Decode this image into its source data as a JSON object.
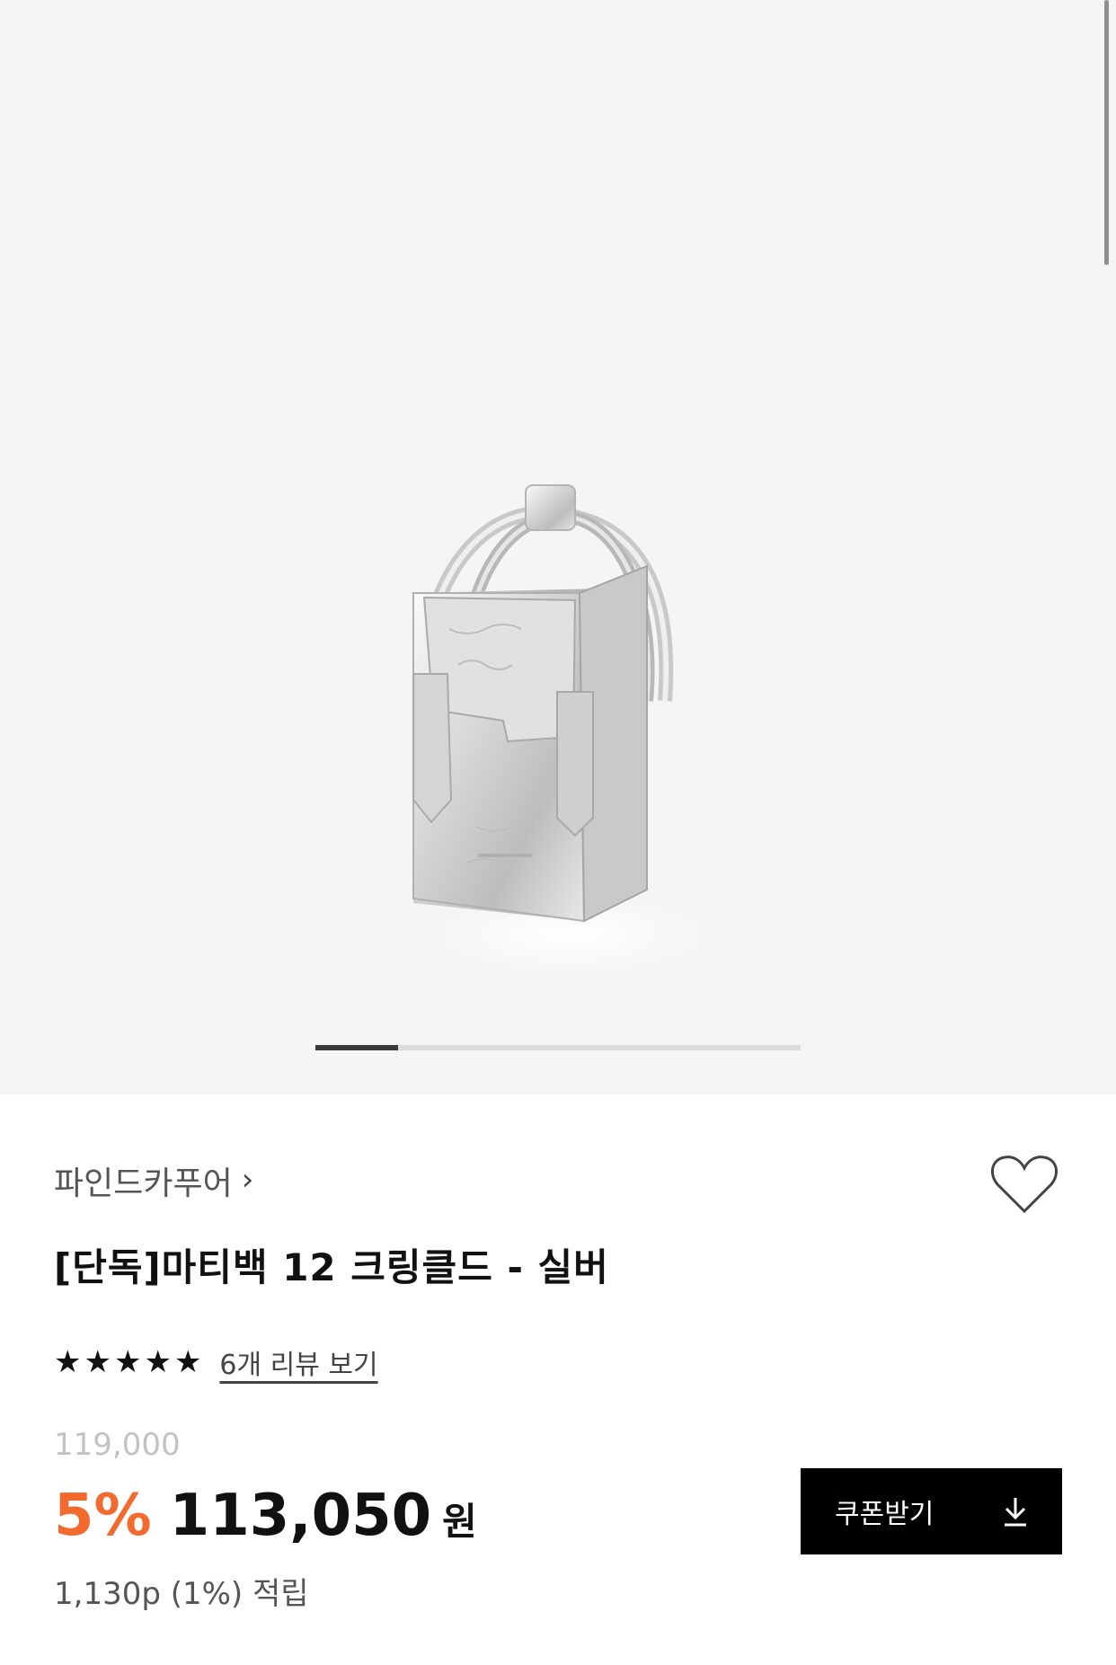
{
  "gallery": {
    "image_alt": "silver mini bag",
    "slide_progress": 0.17
  },
  "product": {
    "brand": "파인드카푸어",
    "chevron": "›",
    "title": "[단독]마티백 12 크링클드 - 실버",
    "rating_stars": 5,
    "reviews_link": "6개 리뷰 보기",
    "original_price": "119,000",
    "discount": "5%",
    "price": "113,050",
    "currency": "원",
    "points": "1,130p (1%) 적립"
  },
  "actions": {
    "coupon_label": "쿠폰받기",
    "coupon_icon": "download-icon",
    "wishlist_icon": "heart-icon"
  },
  "colors": {
    "discount": "#f26a2e",
    "button_bg": "#000000"
  }
}
